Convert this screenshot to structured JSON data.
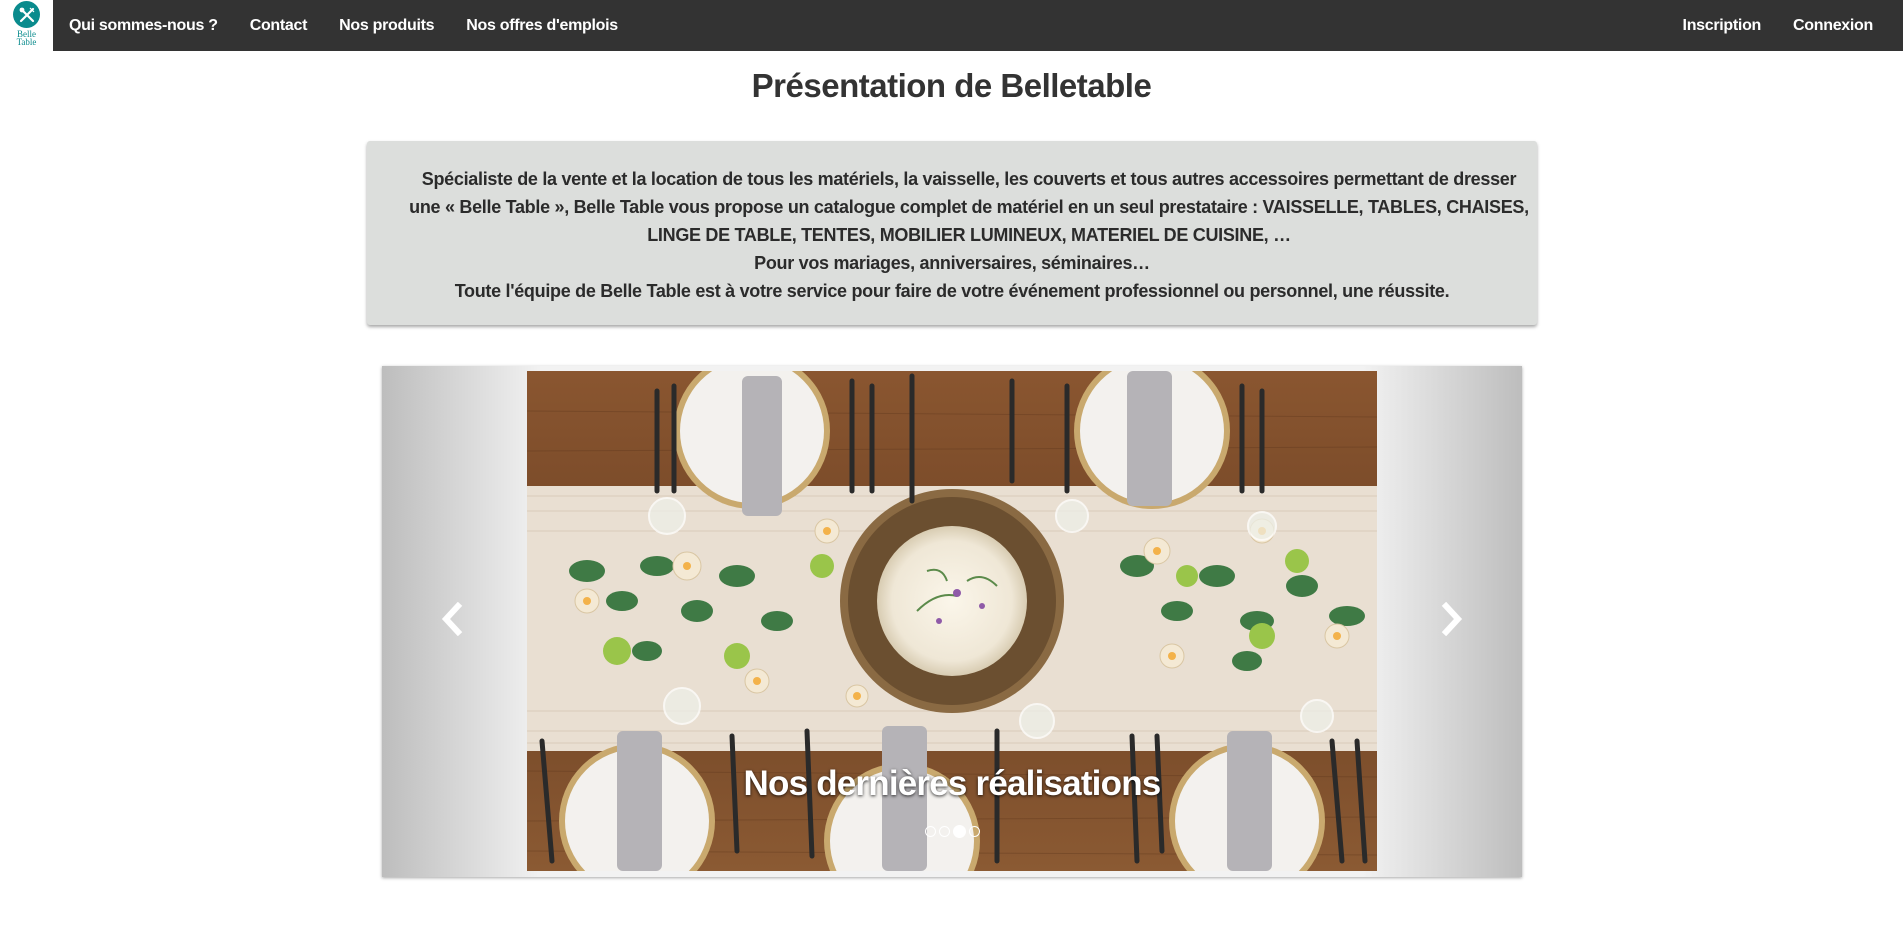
{
  "brand": {
    "logo_icon": "fork-knife-icon",
    "name_line1": "Belle",
    "name_line2": "Table",
    "accent_color": "#0a8b8d"
  },
  "nav": {
    "left": [
      {
        "label": "Qui sommes-nous ?"
      },
      {
        "label": "Contact"
      },
      {
        "label": "Nos produits"
      },
      {
        "label": "Nos offres d'emplois"
      }
    ],
    "right": [
      {
        "label": "Inscription"
      },
      {
        "label": "Connexion"
      }
    ]
  },
  "main": {
    "title": "Présentation de Belletable",
    "presentation": {
      "paragraph1": "Spécialiste de la vente et la location de tous les matériels, la vaisselle, les couverts et tous autres accessoires permettant de dresser une « Belle Table », Belle Table vous propose un catalogue complet de matériel en un seul prestataire : VAISSELLE, TABLES, CHAISES, LINGE DE TABLE, TENTES, MOBILIER LUMINEUX, MATERIEL DE CUISINE, …",
      "paragraph2": "Pour vos mariages, anniversaires, séminaires…",
      "paragraph3": "Toute l'équipe de Belle Table est à votre service pour faire de votre événement professionnel ou personnel, une réussite."
    },
    "carousel": {
      "caption": "Nos dernières réalisations",
      "slide_image": "table-setting-photo",
      "prev_icon": "chevron-left-icon",
      "next_icon": "chevron-right-icon",
      "slide_count": 4,
      "active_index": 2
    }
  }
}
